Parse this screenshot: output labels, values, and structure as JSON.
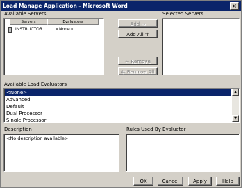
{
  "window": {
    "title": "Load Manage Application - Microsoft Word",
    "close_glyph": "×"
  },
  "available_servers": {
    "label": "Available Servers",
    "columns": [
      "Servers",
      "Evaluators"
    ],
    "rows": [
      {
        "server": "INSTRUCTOR",
        "evaluator": "<None>"
      }
    ]
  },
  "selected_servers": {
    "label": "Selected Servers"
  },
  "buttons": {
    "add": "Add",
    "add_arrow": "→",
    "add_all": "Add All",
    "add_all_arrow": "⇈",
    "remove": "Remove",
    "remove_arrow": "←",
    "remove_all": "Remove All",
    "remove_all_arrow": "⇇",
    "ok": "OK",
    "cancel": "Cancel",
    "apply": "Apply",
    "help": "Help"
  },
  "load_evaluators": {
    "label": "Available Load Evaluators",
    "items": [
      "<None>",
      "Advanced",
      "Default",
      "Dual Processor",
      "Single Processor"
    ],
    "selected_index": 0
  },
  "description": {
    "label": "Description",
    "text": "<No description available>"
  },
  "rules": {
    "label": "Rules Used By Evaluator"
  },
  "icons": {
    "server": "server-icon",
    "up": "scroll-up-arrow-icon",
    "down": "scroll-down-arrow-icon"
  }
}
